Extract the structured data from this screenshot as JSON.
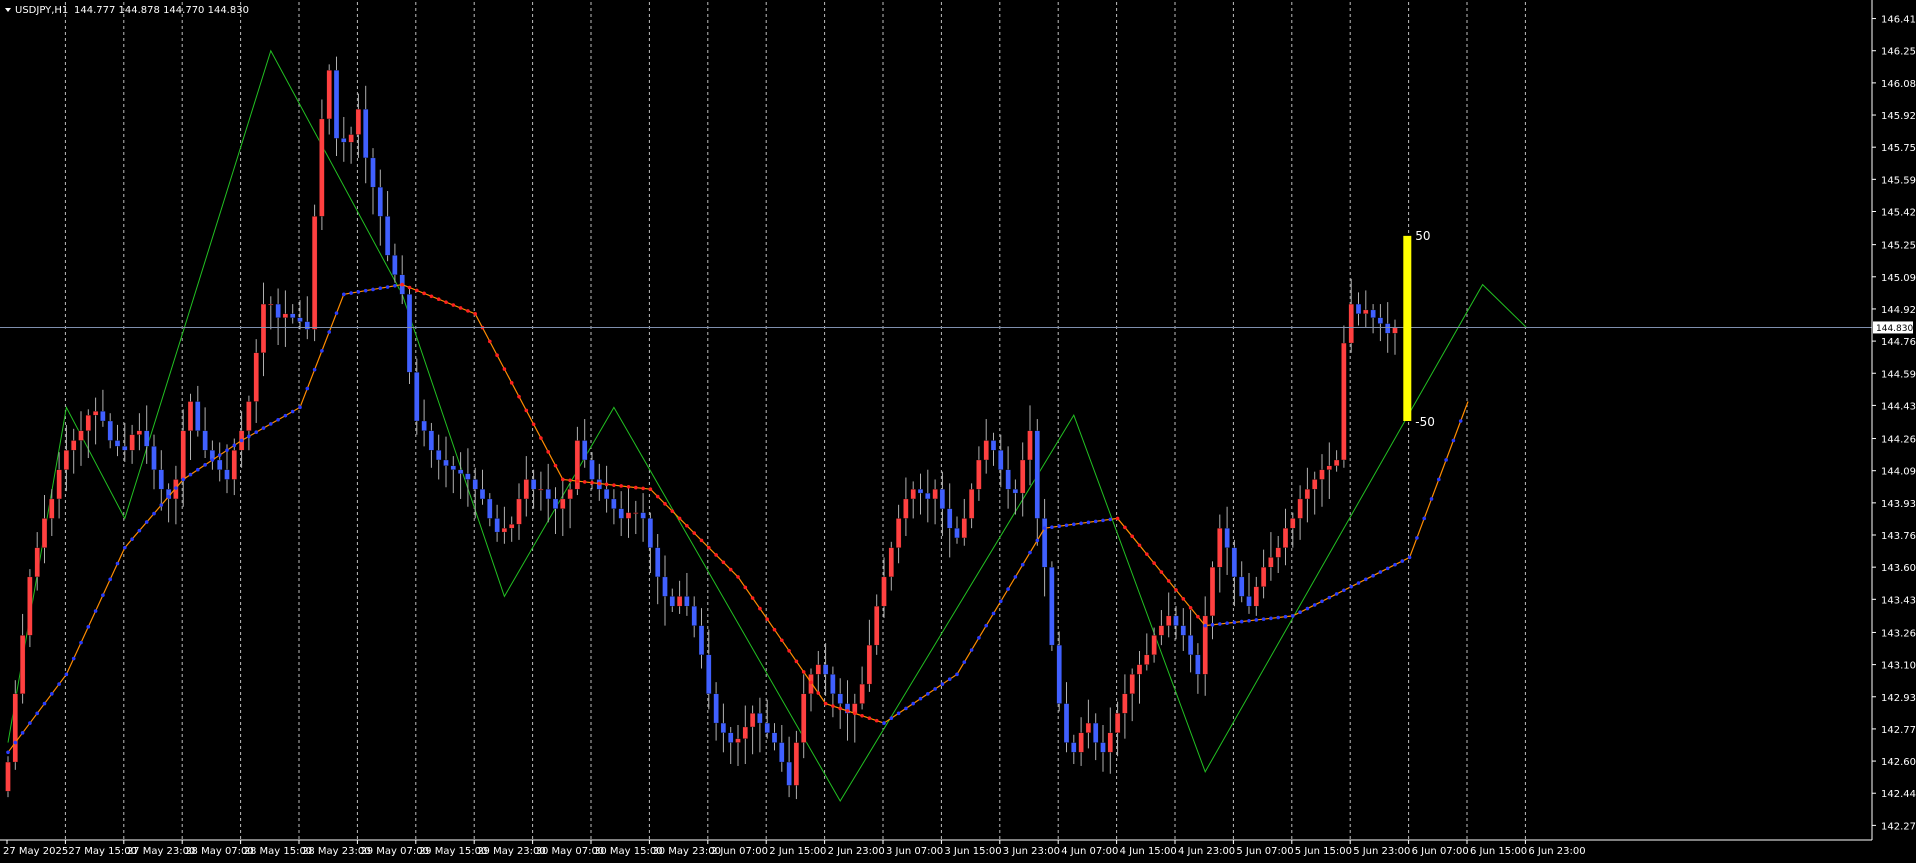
{
  "header": {
    "symbol": "USDJPY,H1",
    "ohlc": "144.777 144.878 144.770 144.830"
  },
  "colors": {
    "background": "#000000",
    "bull": "#ff4040",
    "bear": "#4060ff",
    "wick": "#b0b0b0",
    "zigzag": "#22c022",
    "ma": "#ff8c00",
    "ma_up_marker": "#2a3dff",
    "ma_down_marker": "#ff2020",
    "price_line": "#7f8fae",
    "axis": "#ffffff",
    "grid": "#ffffff",
    "gauge": "#ffff00"
  },
  "chart_data": {
    "type": "candlestick",
    "ylim": [
      142.2,
      146.5
    ],
    "bars_per_day_label": 8,
    "y_ticks": [
      "146.415",
      "146.250",
      "146.085",
      "145.920",
      "145.755",
      "145.590",
      "145.425",
      "145.255",
      "145.090",
      "144.925",
      "144.760",
      "144.595",
      "144.430",
      "144.260",
      "144.095",
      "143.930",
      "143.765",
      "143.600",
      "143.435",
      "143.265",
      "143.100",
      "142.935",
      "142.770",
      "142.605",
      "142.440",
      "142.275"
    ],
    "x_labels": [
      "27 May 2025",
      "27 May 15:00",
      "27 May 23:00",
      "28 May 07:00",
      "28 May 15:00",
      "28 May 23:00",
      "29 May 07:00",
      "29 May 15:00",
      "29 May 23:00",
      "30 May 07:00",
      "30 May 15:00",
      "30 May 23:00",
      "2 Jun 07:00",
      "2 Jun 15:00",
      "2 Jun 23:00",
      "3 Jun 07:00",
      "3 Jun 15:00",
      "3 Jun 23:00",
      "4 Jun 07:00",
      "4 Jun 15:00",
      "4 Jun 23:00",
      "5 Jun 07:00",
      "5 Jun 15:00",
      "5 Jun 23:00",
      "6 Jun 07:00",
      "6 Jun 15:00",
      "6 Jun 23:00"
    ],
    "current_price": "144.830",
    "price_closes": [
      142.6,
      142.95,
      143.25,
      143.55,
      143.7,
      143.85,
      143.95,
      144.1,
      144.2,
      144.25,
      144.3,
      144.38,
      144.4,
      144.35,
      144.25,
      144.22,
      144.2,
      144.28,
      144.3,
      144.22,
      144.1,
      144.0,
      143.95,
      144.05,
      144.3,
      144.45,
      144.3,
      144.2,
      144.15,
      144.1,
      144.05,
      144.2,
      144.3,
      144.45,
      144.7,
      144.95,
      144.95,
      144.88,
      144.9,
      144.88,
      144.86,
      144.82,
      145.4,
      145.9,
      146.15,
      145.8,
      145.78,
      145.82,
      145.95,
      145.7,
      145.55,
      145.4,
      145.2,
      145.1,
      145.0,
      144.6,
      144.35,
      144.3,
      144.2,
      144.15,
      144.12,
      144.1,
      144.08,
      144.05,
      144.0,
      143.95,
      143.85,
      143.78,
      143.8,
      143.82,
      143.95,
      144.05,
      144.0,
      144.0,
      143.95,
      143.9,
      143.95,
      144.0,
      144.25,
      144.15,
      144.05,
      144.0,
      143.95,
      143.9,
      143.85,
      143.88,
      143.88,
      143.85,
      143.7,
      143.55,
      143.45,
      143.4,
      143.45,
      143.4,
      143.3,
      143.15,
      142.95,
      142.8,
      142.75,
      142.7,
      142.72,
      142.78,
      142.85,
      142.8,
      142.75,
      142.7,
      142.6,
      142.48,
      142.7,
      142.95,
      143.05,
      143.1,
      143.05,
      142.95,
      142.9,
      142.85,
      142.9,
      143.0,
      143.2,
      143.4,
      143.55,
      143.7,
      143.85,
      143.95,
      144.0,
      143.98,
      143.95,
      144.0,
      143.9,
      143.8,
      143.75,
      143.85,
      144.0,
      144.15,
      144.25,
      144.2,
      144.1,
      144.0,
      143.98,
      144.15,
      144.3,
      143.85,
      143.6,
      143.2,
      142.9,
      142.7,
      142.65,
      142.75,
      142.8,
      142.7,
      142.65,
      142.75,
      142.85,
      142.95,
      143.05,
      143.1,
      143.15,
      143.25,
      143.3,
      143.35,
      143.3,
      143.25,
      143.15,
      143.05,
      143.35,
      143.6,
      143.8,
      143.7,
      143.55,
      143.45,
      143.4,
      143.5,
      143.6,
      143.65,
      143.7,
      143.8,
      143.85,
      143.95,
      144.0,
      144.05,
      144.1,
      144.12,
      144.15,
      144.75,
      144.95,
      144.9,
      144.92,
      144.88,
      144.85,
      144.8,
      144.83
    ],
    "zigzag": [
      [
        0,
        142.7
      ],
      [
        8,
        144.42
      ],
      [
        16,
        143.85
      ],
      [
        36,
        146.25
      ],
      [
        54,
        145.0
      ],
      [
        68,
        143.45
      ],
      [
        83,
        144.42
      ],
      [
        114,
        142.4
      ],
      [
        146,
        144.38
      ],
      [
        164,
        142.55
      ],
      [
        202,
        145.05
      ],
      [
        208,
        144.83
      ]
    ],
    "ma_line": [
      [
        0,
        142.65
      ],
      [
        8,
        143.05
      ],
      [
        16,
        143.7
      ],
      [
        24,
        144.05
      ],
      [
        32,
        144.25
      ],
      [
        40,
        144.42
      ],
      [
        46,
        145.0
      ],
      [
        54,
        145.05
      ],
      [
        64,
        144.9
      ],
      [
        76,
        144.05
      ],
      [
        88,
        144.0
      ],
      [
        100,
        143.55
      ],
      [
        112,
        142.9
      ],
      [
        120,
        142.8
      ],
      [
        130,
        143.05
      ],
      [
        142,
        143.8
      ],
      [
        152,
        143.85
      ],
      [
        164,
        143.3
      ],
      [
        176,
        143.35
      ],
      [
        192,
        143.65
      ],
      [
        200,
        144.45
      ]
    ],
    "gauge": {
      "top_label": "50",
      "bottom_label": "-50"
    }
  }
}
